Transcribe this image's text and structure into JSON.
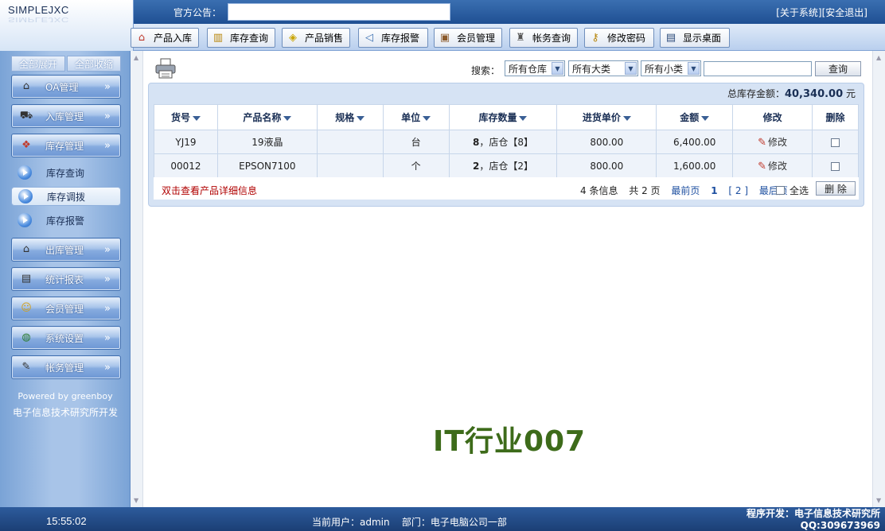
{
  "header": {
    "logo": "SIMPLEJXC",
    "notice_label": "官方公告：",
    "about": "[关于系统]",
    "logout": "[安全退出]"
  },
  "toolbar": [
    {
      "label": "产品入库",
      "icon": "house-icon"
    },
    {
      "label": "库存查询",
      "icon": "book-icon"
    },
    {
      "label": "产品销售",
      "icon": "tag-icon"
    },
    {
      "label": "库存报警",
      "icon": "speaker-icon"
    },
    {
      "label": "会员管理",
      "icon": "id-card-icon"
    },
    {
      "label": "帐务查询",
      "icon": "bottle-icon"
    },
    {
      "label": "修改密码",
      "icon": "key-icon"
    },
    {
      "label": "显示桌面",
      "icon": "desktop-icon"
    }
  ],
  "sidebar": {
    "expand_all": "全部展开",
    "collapse_all": "全部收缩",
    "menus": [
      {
        "label": "OA管理"
      },
      {
        "label": "入库管理"
      },
      {
        "label": "库存管理"
      },
      {
        "label": "出库管理"
      },
      {
        "label": "统计报表"
      },
      {
        "label": "会员管理"
      },
      {
        "label": "系统设置"
      },
      {
        "label": "帐务管理"
      }
    ],
    "sub_items": [
      {
        "label": "库存查询"
      },
      {
        "label": "库存调拨"
      },
      {
        "label": "库存报警"
      }
    ],
    "powered_by": "Powered by greenboy",
    "developer": "电子信息技术研究所开发"
  },
  "search": {
    "label": "搜索：",
    "warehouse": "所有仓库",
    "category": "所有大类",
    "subcategory": "所有小类",
    "query_button": "查询"
  },
  "summary": {
    "label": "总库存金额：",
    "amount": "40,340.00",
    "unit": "元"
  },
  "table": {
    "columns": [
      "货号",
      "产品名称",
      "规格",
      "单位",
      "库存数量",
      "进货单价",
      "金额",
      "修改",
      "删除"
    ],
    "rows": [
      {
        "code": "YJ19",
        "name": "19液晶",
        "spec": "",
        "unit": "台",
        "qty": "8",
        "qty_detail": "，店仓【8】",
        "price": "800.00",
        "amount": "6,400.00",
        "edit": "修改"
      },
      {
        "code": "00012",
        "name": "EPSON7100",
        "spec": "",
        "unit": "个",
        "qty": "2",
        "qty_detail": "，店仓【2】",
        "price": "800.00",
        "amount": "1,600.00",
        "edit": "修改"
      }
    ]
  },
  "footer": {
    "hint": "双击查看产品详细信息",
    "count": "4 条信息",
    "pages": "共 2 页",
    "first": "最前页",
    "page1": "1",
    "page2": "[ 2 ]",
    "last": "最后页",
    "select_all": "全选",
    "delete_button": "删 除"
  },
  "watermark": "IT行业007",
  "status": {
    "time": "15:55:02",
    "user_label": "当前用户：",
    "user": "admin",
    "dept_label": "部门：",
    "dept": "电子电脑公司一部",
    "dev_line1": "程序开发：电子信息技术研究所",
    "dev_line2": "QQ:309673969"
  }
}
